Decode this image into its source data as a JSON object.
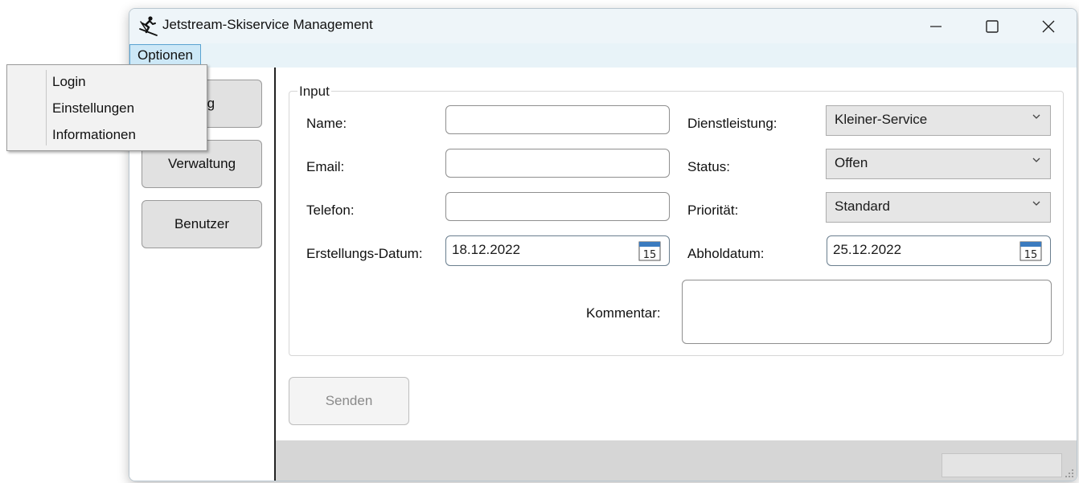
{
  "window": {
    "title": "Jetstream-Skiservice Management",
    "app_icon": "skier-icon",
    "controls": [
      "minimize-icon",
      "maximize-icon",
      "close-icon"
    ]
  },
  "menu": {
    "optionen_label": "Optionen",
    "items": [
      "Login",
      "Einstellungen",
      "Informationen"
    ]
  },
  "sidebar": {
    "buttons": [
      "lung",
      "Verwaltung",
      "Benutzer"
    ]
  },
  "form": {
    "legend": "Input",
    "name_label": "Name:",
    "name_value": "",
    "email_label": "Email:",
    "email_value": "",
    "telefon_label": "Telefon:",
    "telefon_value": "",
    "erstellungsdatum_label": "Erstellungs-Datum:",
    "erstellungsdatum_value": "18.12.2022",
    "dienstleistung_label": "Dienstleistung:",
    "dienstleistung_value": "Kleiner-Service",
    "status_label": "Status:",
    "status_value": "Offen",
    "prioritaet_label": "Priorität:",
    "prioritaet_value": "Standard",
    "abholdatum_label": "Abholdatum:",
    "abholdatum_value": "25.12.2022",
    "kommentar_label": "Kommentar:",
    "kommentar_value": "",
    "calendar_day": "15"
  },
  "actions": {
    "send_label": "Senden"
  },
  "colors": {
    "titlebar_bg": "#eef5f9",
    "menu_highlight": "#cde8f7",
    "menu_highlight_border": "#5aa3d1",
    "calendar_accent": "#3b7bbf"
  }
}
